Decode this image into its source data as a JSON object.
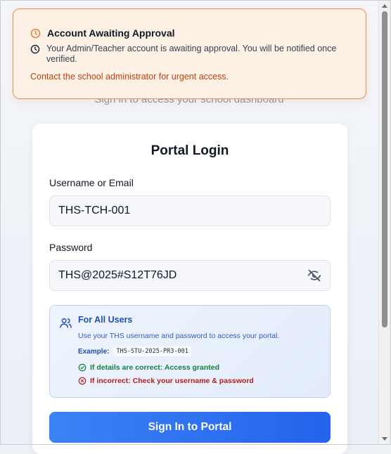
{
  "header": {
    "subtitle": "Sign in to access your school dashboard"
  },
  "toast": {
    "title": "Account Awaiting Approval",
    "message": "Your Admin/Teacher account is awaiting approval. You will be notified once verified.",
    "note": "Contact the school administrator for urgent access.",
    "accent_color": "#ef8a4e"
  },
  "login": {
    "title": "Portal Login",
    "username_label": "Username or Email",
    "username_value": "THS-TCH-001",
    "password_label": "Password",
    "password_value": "THS@2025#S12T76JD",
    "submit_label": "Sign In to Portal"
  },
  "info": {
    "title": "For All Users",
    "text": "Use your THS username and password to access your portal.",
    "example_label": "Example:",
    "example_value": "THS-STU-2025-PR3-001",
    "success_text": "If details are correct: Access granted",
    "error_text": "If incorrect: Check your username & password"
  },
  "colors": {
    "primary": "#2563eb",
    "success": "#15803d",
    "error": "#b91c1c",
    "warning": "#c2410c"
  },
  "icons": [
    "clock-icon",
    "users-icon",
    "eye-off-icon",
    "check-circle-icon",
    "x-circle-icon"
  ]
}
